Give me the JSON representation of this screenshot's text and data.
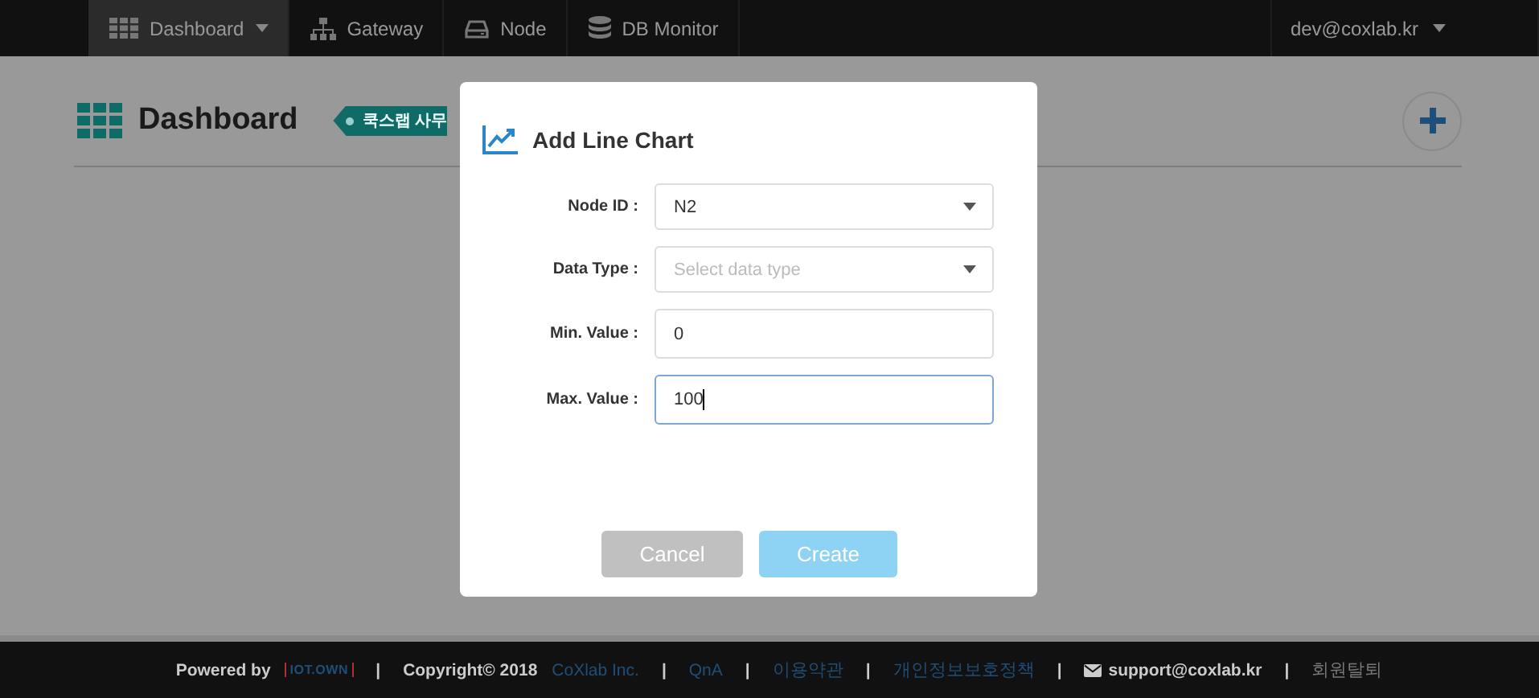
{
  "navbar": {
    "items": [
      {
        "label": "Dashboard",
        "dropdown": true,
        "selected": true
      },
      {
        "label": "Gateway",
        "dropdown": false,
        "selected": false
      },
      {
        "label": "Node",
        "dropdown": false,
        "selected": false
      },
      {
        "label": "DB Monitor",
        "dropdown": false,
        "selected": false
      }
    ],
    "user": {
      "label": "dev@coxlab.kr",
      "dropdown": true
    }
  },
  "header": {
    "title": "Dashboard",
    "tag": "쿡스랩 사무"
  },
  "modal": {
    "title": "Add Line Chart",
    "fields": [
      {
        "kind": "select",
        "label": "Node ID :",
        "value": "N2",
        "focused": false
      },
      {
        "kind": "select",
        "label": "Data Type :",
        "placeholder": "Select data type",
        "focused": false
      },
      {
        "kind": "input",
        "label": "Min. Value :",
        "value": "0",
        "focused": false
      },
      {
        "kind": "input",
        "label": "Max. Value :",
        "value": "100",
        "focused": true
      }
    ],
    "buttons": [
      {
        "kind": "cancel",
        "label": "Cancel"
      },
      {
        "kind": "primary",
        "label": "Create"
      }
    ]
  },
  "footer": {
    "items": [
      {
        "kind": "text",
        "text": "Powered by"
      },
      {
        "kind": "logo",
        "text": "IOT.OWN"
      },
      {
        "kind": "sep",
        "text": "|"
      },
      {
        "kind": "text",
        "text": "Copyright© 2018"
      },
      {
        "kind": "link",
        "text": "CoXlab Inc."
      },
      {
        "kind": "sep",
        "text": "|"
      },
      {
        "kind": "link",
        "text": "QnA"
      },
      {
        "kind": "sep",
        "text": "|"
      },
      {
        "kind": "link",
        "text": "이용약관"
      },
      {
        "kind": "sep",
        "text": "|"
      },
      {
        "kind": "link",
        "text": "개인정보보호정책"
      },
      {
        "kind": "sep",
        "text": "|"
      },
      {
        "kind": "email",
        "text": "support@coxlab.kr"
      },
      {
        "kind": "sep",
        "text": "|"
      },
      {
        "kind": "muted",
        "text": "회원탈퇴"
      }
    ]
  }
}
